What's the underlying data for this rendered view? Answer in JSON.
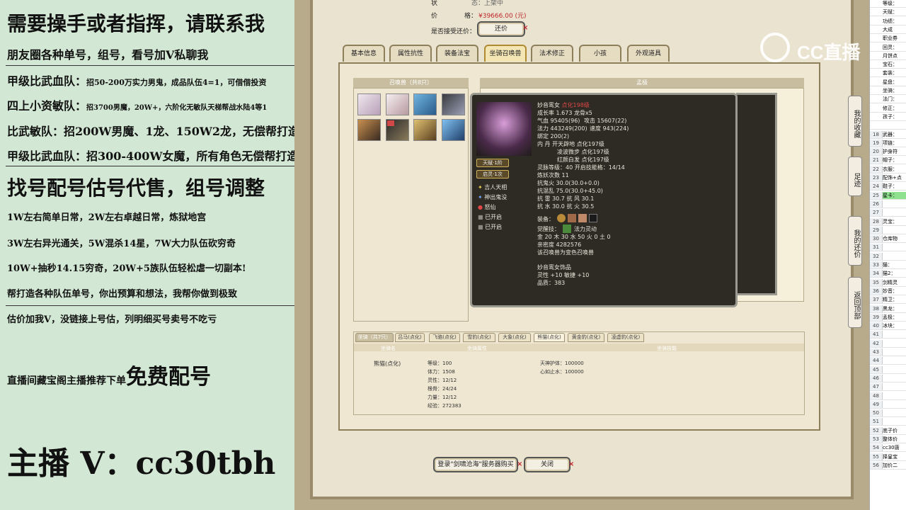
{
  "promo": {
    "l1": "需要操手或者指挥，请联系我",
    "l2": "朋友圈各种单号，组号，看号加V私聊我",
    "l3a": "甲级比武血队：",
    "l3b": "招50-200万实力男鬼，成品队伍4=1，可借借投资",
    "l4a": "四上小资敏队：",
    "l4b": "招3700男魔，20W+，六阶化无敏队天梯帮战水陆4等1",
    "l5": "比武敏队：招200W男魔、1龙、150W2龙，无偿帮打造",
    "l6": "甲级比武血队：招300-400W女魔，所有角色无偿帮打造",
    "l7": "找号配号估号代售，组号调整",
    "l8": "1W左右简单日常，2W左右卓越日常，炼狱地宫",
    "l9": "3W左右异光通关，5W混杀14星，7W大力队伍砍穷奇",
    "l10": "10W+抽秒14.15穷奇，20W+5族队伍轻松虐一切副本!",
    "l11": "帮打造各种队伍单号，你出预算和想法，我帮你做到极致",
    "l12": "估价加我V，没链接上号估，列明细买号卖号不吃亏",
    "l13a": "直播间藏宝阁主播推荐下单",
    "l13b": "免费配号",
    "l14": "主播 V：cc30tbh"
  },
  "game": {
    "status_label": "状",
    "status_value": "态：上架中",
    "price_label": "价",
    "price_label2": "格：",
    "price_value": "¥39666.00 (元)",
    "counter_label": "是否接受还价：",
    "counter_button": "还价",
    "tabs": [
      "基本信息",
      "属性抗性",
      "装备法宝",
      "坐骑召唤兽",
      "法术修正",
      "小孩",
      "外观道具"
    ],
    "active_tab": 3,
    "summons_header": "召唤兽（共8只）",
    "detail_header": "孟极",
    "mounts_header": "坐骑（共7只）",
    "mount_tabs": [
      "吕马(点化)",
      "飞骆(点化)",
      "雪豹(点化)",
      "大象(点化)",
      "熊猫(点化)",
      "黄金豹(点化)",
      "凌虚豹(点化)"
    ],
    "mount_cols": [
      "坐骑名",
      "坐骑属性",
      "坐骑技能"
    ],
    "mount_name": "熊猫(点化)",
    "mount_attrs": [
      "等级：100",
      "体力：1508",
      "灵性：12/12",
      "根骨：24/24",
      "力量：12/12",
      "经验：272383"
    ],
    "mount_skills": [
      "天神护体：100000",
      "心如止水：100000"
    ],
    "login_button": "登录\"剑啸沧海\"服务器购买",
    "close_button": "关闭"
  },
  "tooltip": {
    "name": "妙音鸾女",
    "name_tag": "点化198级",
    "growth": "成长率 1.673 龙骨x5",
    "hp": "气血 95405(96)",
    "atk": "攻击 15607(22)",
    "mp": "法力 443249(200)",
    "spd": "速度 943(224)",
    "bind": "绑定 200(2)",
    "neidan1": "内 丹 开天辟地 点化197级",
    "neidan2": "凌波微步 点化197级",
    "neidan3": "红颜白发 点化197级",
    "spirit": "灵脉等级：40 开启技能格：14/14",
    "refine": "炼妖次数 11",
    "res1": "抗鬼火 30.0(30.0+0.0)",
    "res2": "抗混乱 75.0(30.0+45.0)",
    "res3": "抗 雷 30.7 抗 风 30.1",
    "res4": "抗 水 30.0 抗 火 30.5",
    "equip_label": "装备：",
    "awaken": "觉醒技：",
    "awaken_skill": "法力灵动",
    "elements": "金 20 木 30 水 50 火 0 土 0",
    "intimacy": "亲密度 4282576",
    "note": "该召唤兽为变色召唤兽",
    "ornament": "妙音鸾女饰品",
    "orn1": "灵性 +10 敏捷 +10",
    "orn2": "品质：383",
    "side_buttons": [
      "天赋·1阶",
      "启灵·1次"
    ],
    "side_items": [
      "吉人天相",
      "神出鬼没",
      "怒仙",
      "已开启",
      "已开启"
    ]
  },
  "sidebar": {
    "b1": "我的收藏",
    "b2": "足迹",
    "b3": "我的还价",
    "b4": "返回顶部"
  },
  "sheet": {
    "rows": [
      [
        "",
        "等级："
      ],
      [
        "",
        "天赋："
      ],
      [
        "",
        "功绩："
      ],
      [
        "",
        "大成"
      ],
      [
        "",
        "职业券"
      ],
      [
        "",
        "回灵："
      ],
      [
        "",
        "月饼点"
      ],
      [
        "",
        "宝石："
      ],
      [
        "",
        "套装："
      ],
      [
        "",
        "星盘："
      ],
      [
        "",
        "坐骑："
      ],
      [
        "",
        "法门："
      ],
      [
        "",
        "修正："
      ],
      [
        "",
        "孩子："
      ],
      [
        "",
        ""
      ],
      [
        "18",
        "武器："
      ],
      [
        "19",
        "项链："
      ],
      [
        "20",
        "护身符"
      ],
      [
        "21",
        "帽子："
      ],
      [
        "22",
        "衣服："
      ],
      [
        "23",
        "配饰+点"
      ],
      [
        "24",
        "鞋子："
      ],
      [
        "25",
        "星卡："
      ],
      [
        "26",
        ""
      ],
      [
        "27",
        ""
      ],
      [
        "28",
        "灵宝："
      ],
      [
        "29",
        ""
      ],
      [
        "30",
        "仓库物"
      ],
      [
        "31",
        ""
      ],
      [
        "32",
        ""
      ],
      [
        "33",
        "猫："
      ],
      [
        "34",
        "猫2："
      ],
      [
        "35",
        "剑精灵"
      ],
      [
        "36",
        "妙音："
      ],
      [
        "37",
        "精卫："
      ],
      [
        "38",
        "黑龙："
      ],
      [
        "39",
        "孟极："
      ],
      [
        "40",
        "冰块："
      ]
    ],
    "rows2": [
      [
        "41",
        ""
      ],
      [
        "42",
        ""
      ],
      [
        "43",
        ""
      ],
      [
        "44",
        ""
      ],
      [
        "45",
        ""
      ],
      [
        "46",
        ""
      ],
      [
        "47",
        ""
      ],
      [
        "48",
        ""
      ],
      [
        "49",
        ""
      ],
      [
        "50",
        ""
      ],
      [
        "51",
        ""
      ],
      [
        "52",
        "底子价"
      ],
      [
        "53",
        "整体价"
      ],
      [
        "54",
        "cc30唐"
      ],
      [
        "55",
        "择皇宝"
      ],
      [
        "56",
        "加价二"
      ]
    ]
  },
  "watermark": "CC直播"
}
